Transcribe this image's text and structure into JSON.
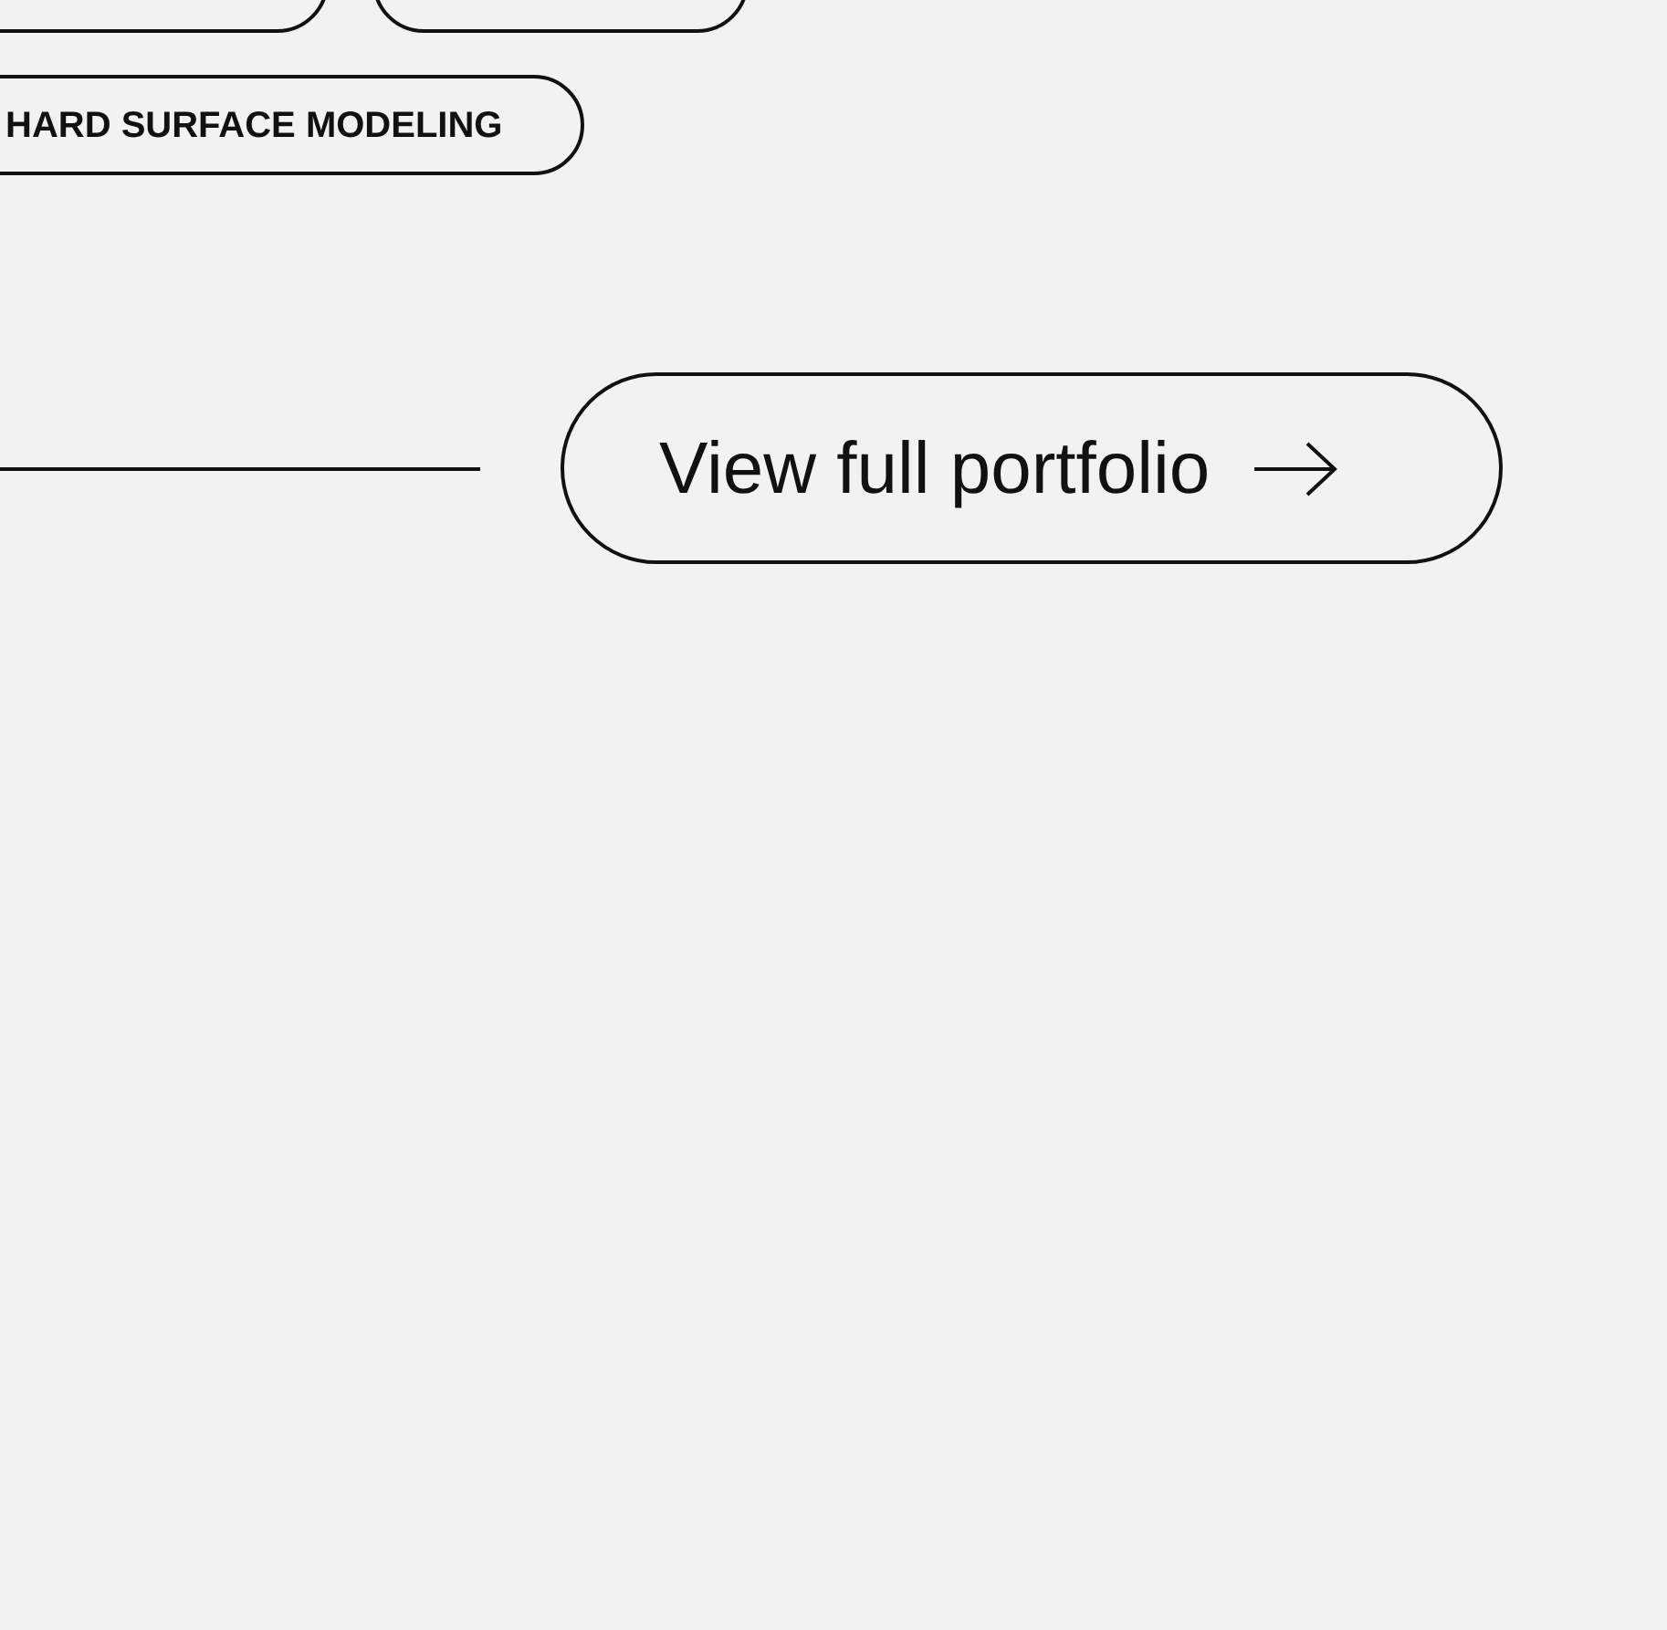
{
  "tags": [
    {
      "label": "HARD SURFACE MODELING"
    }
  ],
  "cta": {
    "label": "View full portfolio"
  }
}
